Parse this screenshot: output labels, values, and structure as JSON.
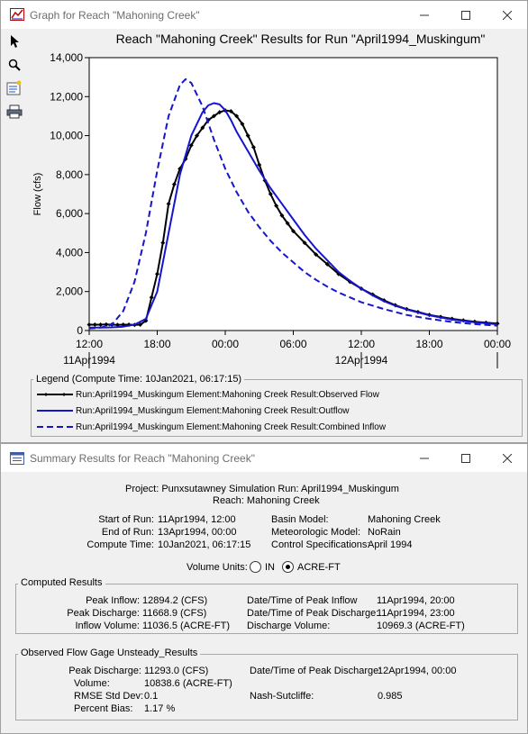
{
  "graph_window": {
    "title": "Graph for Reach \"Mahoning Creek\""
  },
  "summary_window": {
    "title": "Summary Results for Reach \"Mahoning Creek\"",
    "project_line": "Project: Punxsutawney     Simulation Run: April1994_Muskingum",
    "reach_line": "Reach: Mahoning Creek",
    "run_info": {
      "start_of_run_label": "Start of Run:",
      "start_of_run": "11Apr1994, 12:00",
      "end_of_run_label": "End of Run:",
      "end_of_run": "13Apr1994, 00:00",
      "compute_time_label": "Compute Time:",
      "compute_time": "10Jan2021, 06:17:15",
      "basin_model_label": "Basin Model:",
      "basin_model": "Mahoning Creek",
      "met_model_label": "Meteorologic Model:",
      "met_model": "NoRain",
      "control_label": "Control Specifications:",
      "control": "April 1994"
    },
    "volume_units": {
      "label": "Volume Units:",
      "options": [
        "IN",
        "ACRE-FT"
      ],
      "selected": "ACRE-FT"
    },
    "computed_results": {
      "title": "Computed Results",
      "peak_inflow_label": "Peak Inflow:",
      "peak_inflow": "12894.2 (CFS)",
      "peak_discharge_label": "Peak Discharge:",
      "peak_discharge": "11668.9 (CFS)",
      "inflow_volume_label": "Inflow Volume:",
      "inflow_volume": "11036.5 (ACRE-FT)",
      "peak_inflow_time_label": "Date/Time of Peak Inflow",
      "peak_inflow_time": "11Apr1994, 20:00",
      "peak_discharge_time_label": "Date/Time of Peak Discharge:",
      "peak_discharge_time": "11Apr1994, 23:00",
      "discharge_volume_label": "Discharge Volume:",
      "discharge_volume": "10969.3 (ACRE-FT)"
    },
    "observed_results": {
      "title": "Observed Flow Gage Unsteady_Results",
      "peak_discharge_label": "Peak Discharge:",
      "peak_discharge": "11293.0 (CFS)",
      "volume_label": "Volume:",
      "volume": "10838.6 (ACRE-FT)",
      "rmse_label": "RMSE Std Dev:",
      "rmse": "0.1",
      "bias_label": "Percent Bias:",
      "bias": "1.17 %",
      "peak_time_label": "Date/Time of Peak Discharge:",
      "peak_time": "12Apr1994, 00:00",
      "nash_label": "Nash-Sutcliffe:",
      "nash": "0.985"
    }
  },
  "chart_data": {
    "type": "line",
    "title": "Reach \"Mahoning Creek\" Results for Run \"April1994_Muskingum\"",
    "xlabel": "",
    "ylabel": "Flow (cfs)",
    "x_unit": "hours from 11Apr1994 12:00",
    "xlim": [
      0,
      36
    ],
    "ylim": [
      0,
      14000
    ],
    "x_tick_labels": [
      "12:00",
      "18:00",
      "00:00",
      "06:00",
      "12:00",
      "18:00",
      "00:00"
    ],
    "x_tick_values": [
      0,
      6,
      12,
      18,
      24,
      30,
      36
    ],
    "date_labels": [
      {
        "x": 0,
        "text": "11Apr1994"
      },
      {
        "x": 24,
        "text": "12Apr1994"
      }
    ],
    "y_tick_labels": [
      "0",
      "2,000",
      "4,000",
      "6,000",
      "8,000",
      "10,000",
      "12,000",
      "14,000"
    ],
    "y_tick_values": [
      0,
      2000,
      4000,
      6000,
      8000,
      10000,
      12000,
      14000
    ],
    "grid": false,
    "legend": {
      "title": "Legend (Compute Time: 10Jan2021, 06:17:15)",
      "placement": "bottom"
    },
    "series": [
      {
        "name": "Run:April1994_Muskingum Element:Mahoning Creek Result:Observed Flow",
        "color": "#000000",
        "style": "solid-markers",
        "x": [
          0,
          0.5,
          1,
          1.5,
          2,
          2.5,
          3,
          3.5,
          4,
          4.5,
          5,
          5.5,
          6,
          6.5,
          7,
          7.5,
          8,
          8.5,
          9,
          9.5,
          10,
          10.5,
          11,
          11.5,
          12,
          12.5,
          13,
          13.5,
          14,
          14.5,
          15,
          15.5,
          16,
          16.5,
          17,
          17.5,
          18,
          19,
          20,
          21,
          22,
          23,
          24,
          25,
          26,
          27,
          28,
          29,
          30,
          31,
          32,
          33,
          34,
          35,
          36
        ],
        "values": [
          300,
          300,
          300,
          310,
          300,
          290,
          300,
          300,
          290,
          300,
          500,
          1700,
          2900,
          4500,
          6500,
          7500,
          8300,
          8800,
          9500,
          10000,
          10400,
          10800,
          11000,
          11200,
          11293,
          11250,
          11000,
          10600,
          10000,
          9400,
          8500,
          7700,
          7000,
          6400,
          5900,
          5500,
          5100,
          4500,
          3900,
          3400,
          2900,
          2500,
          2150,
          1850,
          1550,
          1300,
          1100,
          950,
          800,
          700,
          600,
          520,
          450,
          400,
          360
        ]
      },
      {
        "name": "Run:April1994_Muskingum Element:Mahoning Creek Result:Outflow",
        "color": "#1515d0",
        "style": "solid",
        "x": [
          0,
          1,
          2,
          3,
          4,
          5,
          6,
          7,
          8,
          9,
          10,
          10.5,
          11,
          11.5,
          12,
          12.5,
          13,
          14,
          15,
          16,
          17,
          18,
          19,
          20,
          21,
          22,
          23,
          24,
          25,
          26,
          27,
          28,
          30,
          32,
          34,
          36
        ],
        "values": [
          150,
          150,
          160,
          200,
          300,
          600,
          2000,
          5000,
          8000,
          10000,
          11200,
          11550,
          11668.9,
          11600,
          11300,
          10800,
          10200,
          9200,
          8200,
          7300,
          6500,
          5700,
          4900,
          4200,
          3600,
          3000,
          2550,
          2150,
          1800,
          1500,
          1270,
          1080,
          780,
          560,
          420,
          320
        ]
      },
      {
        "name": "Run:April1994_Muskingum Element:Mahoning Creek Result:Combined Inflow",
        "color": "#1515d0",
        "style": "dashed",
        "x": [
          0,
          1,
          2,
          3,
          4,
          5,
          6,
          7,
          8,
          8.5,
          9,
          10,
          11,
          12,
          13,
          14,
          15,
          16,
          17,
          18,
          19,
          20,
          21,
          22,
          23,
          24,
          26,
          28,
          30,
          32,
          34,
          36
        ],
        "values": [
          100,
          150,
          300,
          1000,
          2500,
          5000,
          8200,
          11000,
          12600,
          12894.2,
          12700,
          11500,
          9800,
          8300,
          7100,
          6100,
          5300,
          4600,
          4000,
          3500,
          3000,
          2600,
          2250,
          1950,
          1700,
          1450,
          1100,
          800,
          600,
          440,
          330,
          250
        ]
      }
    ]
  }
}
